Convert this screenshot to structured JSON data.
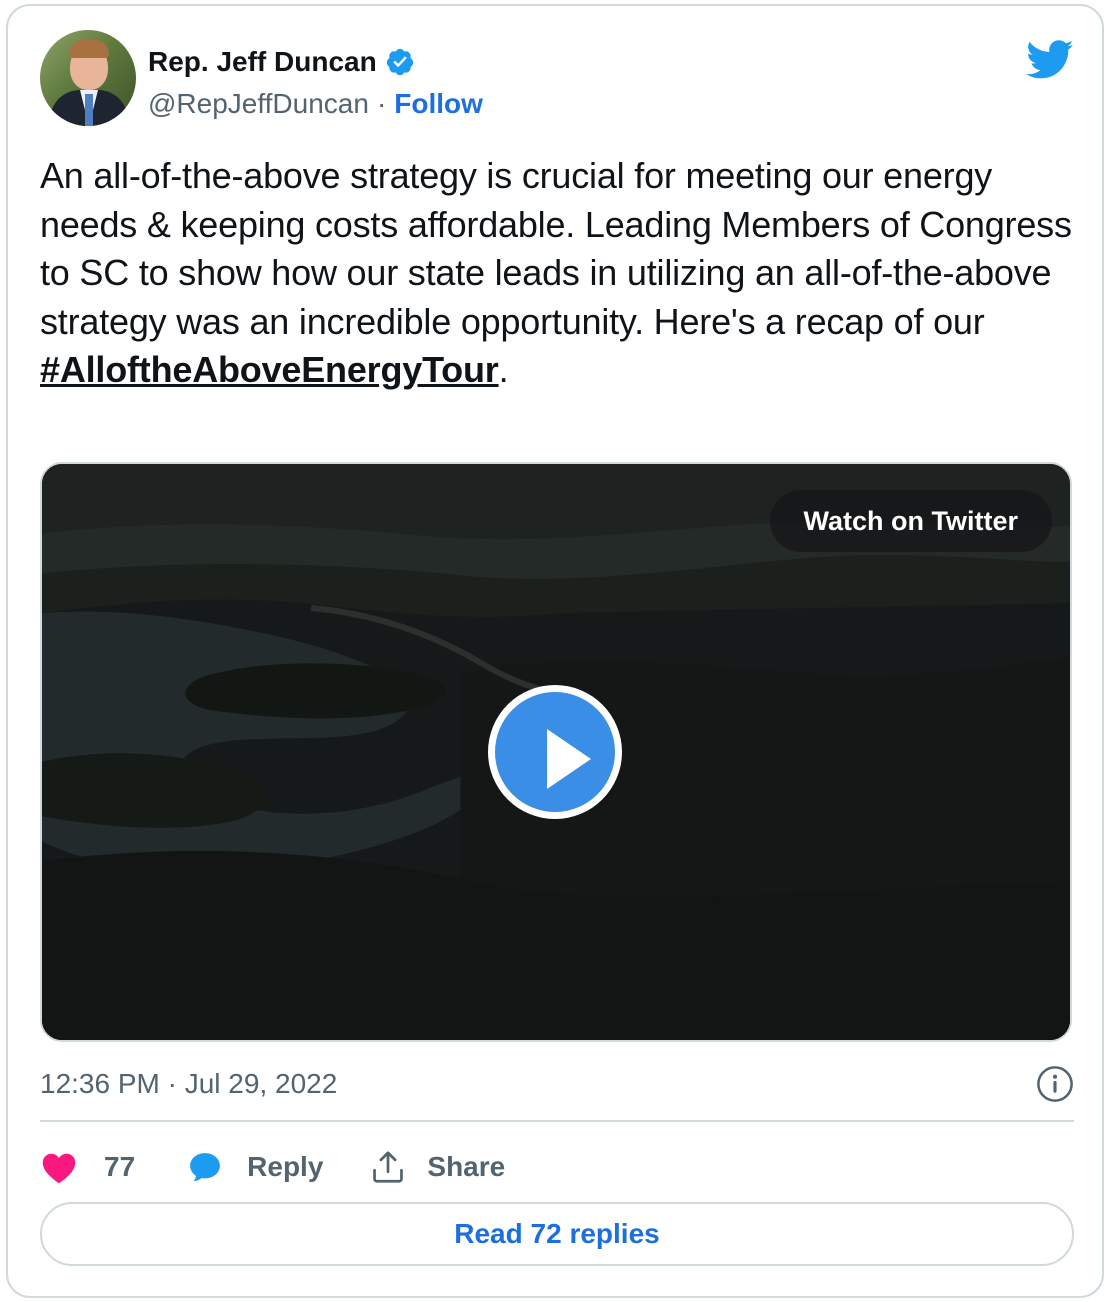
{
  "author": {
    "display_name": "Rep. Jeff Duncan",
    "handle": "@RepJeffDuncan",
    "separator": "·",
    "follow_label": "Follow",
    "verified": true
  },
  "tweet": {
    "text": "An all-of-the-above strategy is crucial for meeting our energy needs & keeping costs affordable. Leading Members of Congress to SC to show how our state leads in utilizing an all-of-the-above strategy was an incredible opportunity. Here's a recap of our ",
    "hashtag": "#AlloftheAboveEnergyTour",
    "trailing": "."
  },
  "media": {
    "watch_label": "Watch on Twitter",
    "play_icon": "play-icon"
  },
  "meta": {
    "timestamp": "12:36 PM · Jul 29, 2022"
  },
  "actions": {
    "like_count": "77",
    "reply_label": "Reply",
    "share_label": "Share"
  },
  "footer": {
    "read_replies_label": "Read 72 replies"
  },
  "colors": {
    "accent": "#1d9bf0",
    "link": "#1d6fe0",
    "like": "#f91880",
    "border": "#cfd9de",
    "muted": "#536471"
  }
}
